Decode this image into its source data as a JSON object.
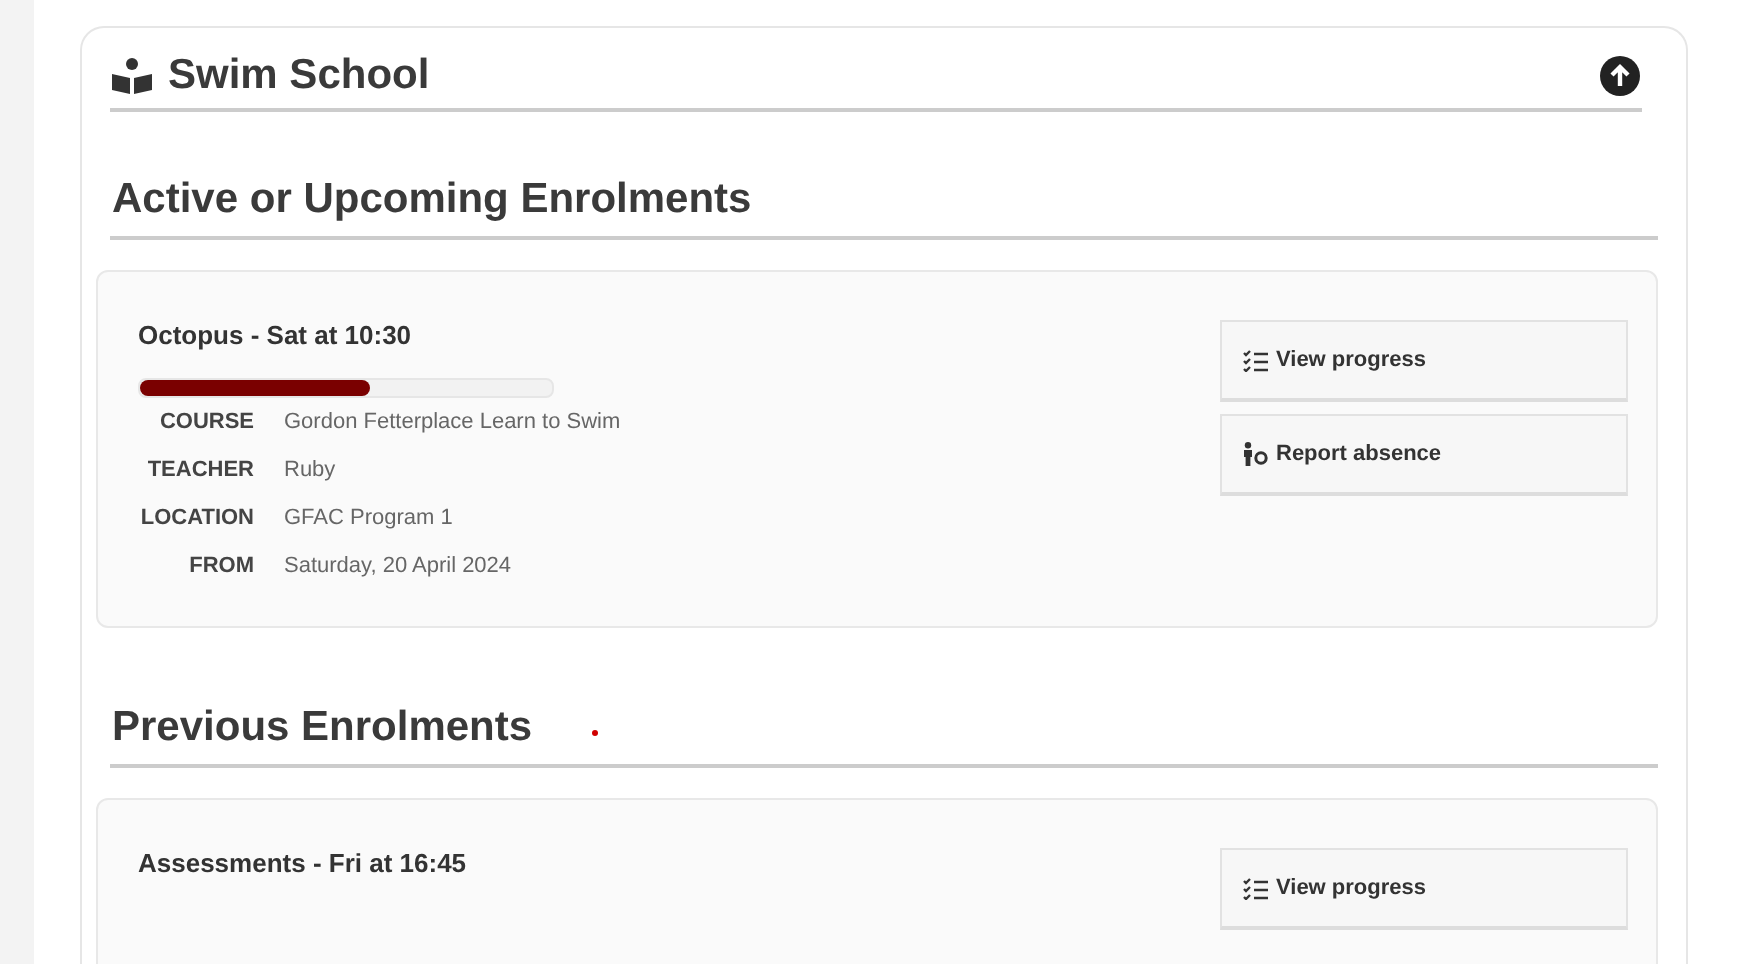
{
  "panel": {
    "title": "Swim School"
  },
  "sections": [
    {
      "heading": "Active or Upcoming Enrolments",
      "marker": false,
      "enrolments": [
        {
          "title": "Octopus - Sat at 10:30",
          "level": 0.56,
          "details": [
            {
              "label": "COURSE",
              "value": "Gordon Fetterplace Learn to Swim"
            },
            {
              "label": "TEACHER",
              "value": "Ruby"
            },
            {
              "label": "LOCATION",
              "value": "GFAC Program 1"
            },
            {
              "label": "FROM",
              "value": "Saturday, 20 April 2024"
            }
          ],
          "actions": [
            {
              "kind": "progress",
              "label": "View progress"
            },
            {
              "kind": "absence",
              "label": "Report absence"
            }
          ]
        }
      ]
    },
    {
      "heading": "Previous Enrolments",
      "marker": true,
      "enrolments": [
        {
          "title": "Assessments - Fri at 16:45",
          "actions": [
            {
              "kind": "progress",
              "label": "View progress"
            }
          ]
        }
      ]
    }
  ]
}
